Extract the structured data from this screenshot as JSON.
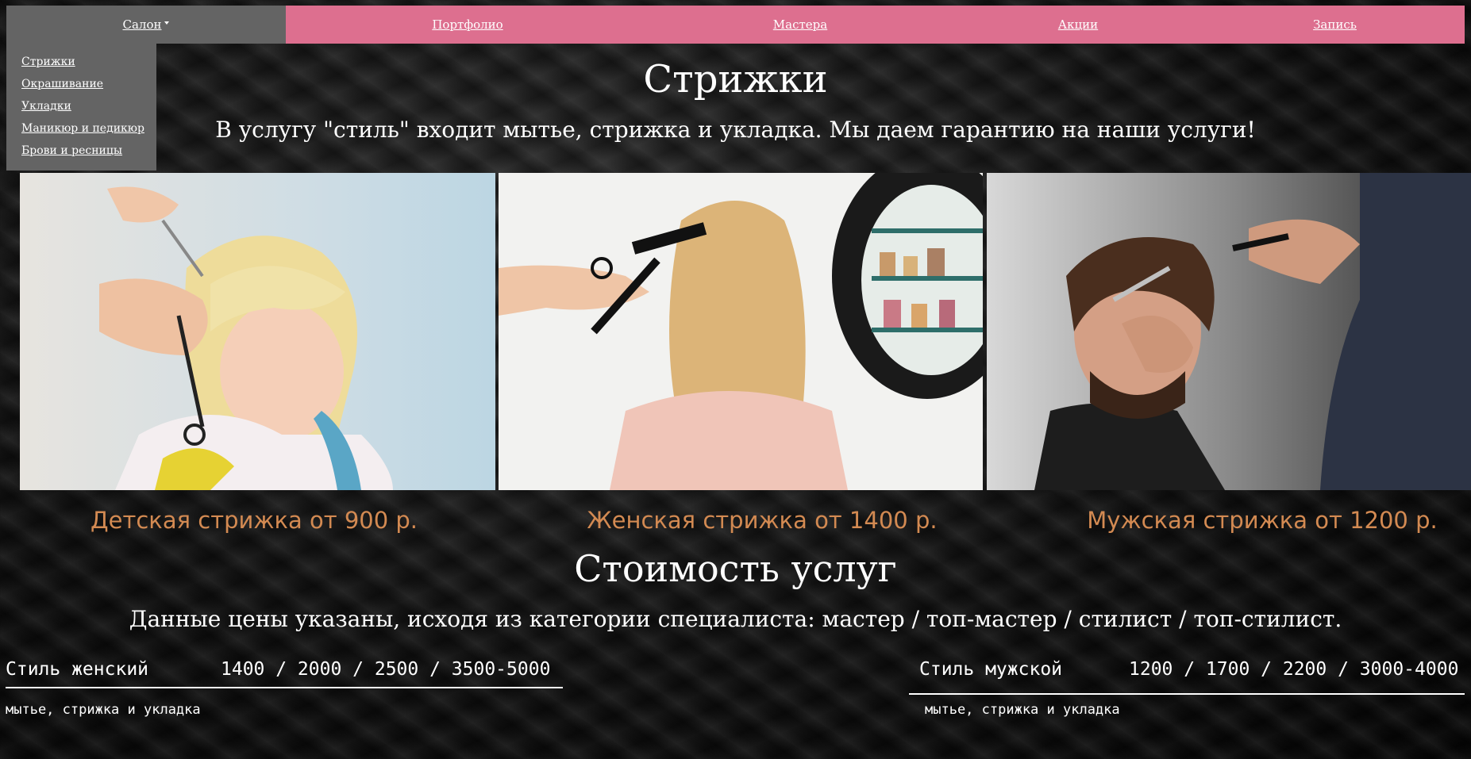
{
  "nav": {
    "items": [
      {
        "label": "Салон"
      },
      {
        "label": "Портфолио"
      },
      {
        "label": "Мастера"
      },
      {
        "label": "Акции"
      },
      {
        "label": "Запись"
      }
    ],
    "dropdown": [
      "Стрижки",
      "Окрашивание",
      "Укладки",
      "Маникюр и педикюр",
      "Брови и ресницы"
    ]
  },
  "hero": {
    "title": "Стрижки",
    "subtitle": "В услугу \"стиль\" входит мытье, стрижка и укладка. Мы даем гарантию на наши услуги!"
  },
  "services": [
    {
      "caption": "Детская стрижка от 900 р."
    },
    {
      "caption": "Женская стрижка от 1400 р."
    },
    {
      "caption": "Мужская стрижка от 1200 р."
    }
  ],
  "pricing": {
    "title": "Стоимость услуг",
    "note": "Данные цены указаны, исходя из категории специалиста: мастер / топ-мастер / стилист / топ-стилист.",
    "rows": [
      {
        "name": "Стиль женский",
        "prices": "1400 / 2000 / 2500 / 3500-5000",
        "desc": "мытье, стрижка и укладка"
      },
      {
        "name": "Стиль мужской",
        "prices": "1200 / 1700 / 2200 / 3000-4000",
        "desc": "мытье, стрижка и укладка"
      }
    ]
  },
  "colors": {
    "nav_bg": "#dd6f8f",
    "nav_active_bg": "#646464",
    "caption": "#d38a52"
  }
}
